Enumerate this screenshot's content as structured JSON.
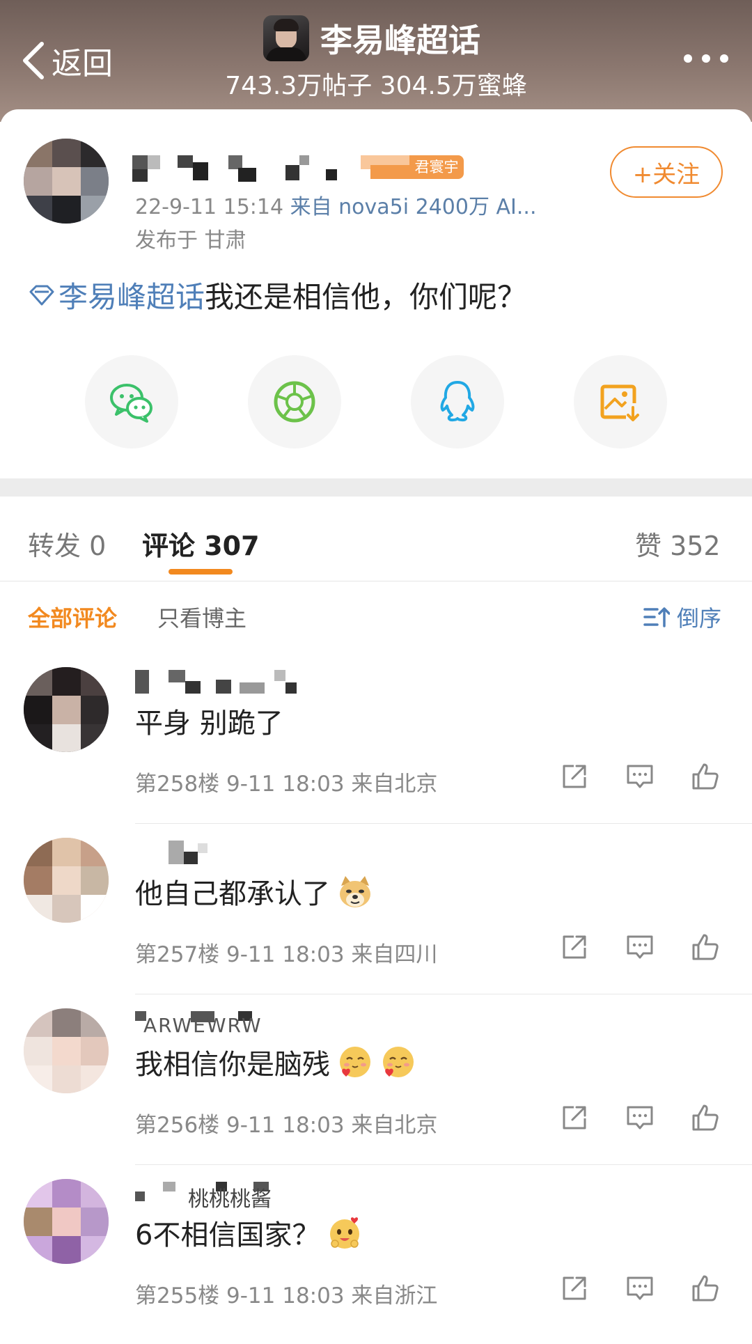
{
  "header": {
    "back_label": "返回",
    "title": "李易峰超话",
    "subtitle": "743.3万帖子 304.5万蜜蜂"
  },
  "post": {
    "badge_text": "君寰宇",
    "follow_label": "+关注",
    "meta_time": "22-9-11 15:14",
    "meta_source": "来自 nova5i 2400万 AI...",
    "location": "发布于 甘肃",
    "topic": "李易峰超话",
    "text": "我还是相信他，你们呢？",
    "share_icons": [
      "wechat-icon",
      "moments-icon",
      "qq-icon",
      "save-image-icon"
    ]
  },
  "tabs": {
    "repost": "转发 0",
    "comments": "评论 307",
    "likes": "赞 352"
  },
  "filters": {
    "all": "全部评论",
    "author_only": "只看博主",
    "sort": "倒序"
  },
  "comments": [
    {
      "name_visible": "",
      "text": "平身 别跪了",
      "emoji": null,
      "meta": "第258楼 9-11 18:03 来自北京"
    },
    {
      "name_visible": "",
      "text": "他自己都承认了",
      "emoji": "doge-emoji",
      "meta": "第257楼 9-11 18:03 来自四川"
    },
    {
      "name_visible": "ARWEWRW",
      "text": "我相信你是脑残",
      "emoji": "love-emoji",
      "meta": "第256楼 9-11 18:03 来自北京"
    },
    {
      "name_visible": "桃桃桃酱",
      "text": "6不相信国家？",
      "emoji": "cute-emoji",
      "meta": "第255楼 9-11 18:03 来自浙江"
    }
  ],
  "colors": {
    "accent_orange": "#f2891f",
    "link_blue": "#4f7fb8",
    "header_brown": "#7d6b64"
  }
}
